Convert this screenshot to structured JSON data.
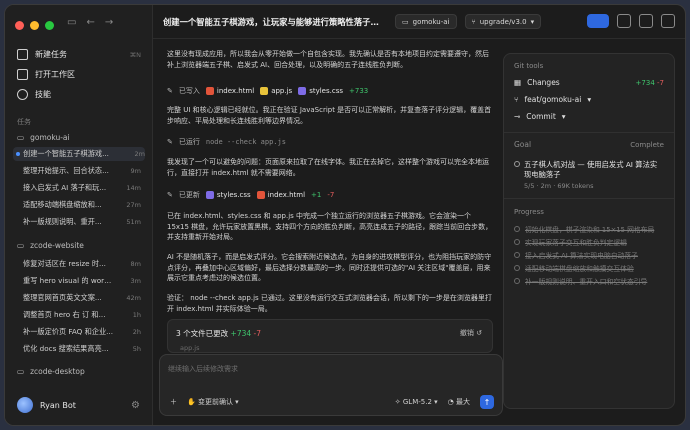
{
  "sidebar": {
    "nav": [
      {
        "label": "新建任务",
        "shortcut": "⌘N"
      },
      {
        "label": "打开工作区",
        "shortcut": ""
      },
      {
        "label": "技能",
        "shortcut": ""
      }
    ],
    "section_label": "任务",
    "groups": [
      {
        "name": "gomoku-ai",
        "tasks": [
          {
            "title": "创建一个智能五子棋游戏...",
            "age": "2m",
            "active": true
          },
          {
            "title": "整理开始提示、回合状态...",
            "age": "9m"
          },
          {
            "title": "接入启发式 AI 落子和玩...",
            "age": "14m"
          },
          {
            "title": "适配移动端棋盘缩放和...",
            "age": "27m"
          },
          {
            "title": "补一版规则说明、重开...",
            "age": "51m"
          }
        ]
      },
      {
        "name": "zcode-website",
        "tasks": [
          {
            "title": "修复对话区在 resize 时...",
            "age": "8m"
          },
          {
            "title": "重写 hero visual 的 work...",
            "age": "3m"
          },
          {
            "title": "整理官网首页英文文案...",
            "age": "42m"
          },
          {
            "title": "调整首页 hero 右 订 和...",
            "age": "1h"
          },
          {
            "title": "补一版定价页 FAQ 和企业...",
            "age": "2h"
          },
          {
            "title": "优化 docs 搜索结果高亮...",
            "age": "5h"
          }
        ]
      },
      {
        "name": "zcode-desktop",
        "tasks": []
      }
    ],
    "user": {
      "name": "Ryan Bot"
    }
  },
  "header": {
    "title": "创建一个智能五子棋游戏，让玩家与能够进行策略性落子并准确判断...",
    "workspace": "gomoku-ai",
    "branch": "upgrade/v3.0"
  },
  "chat": {
    "p1": "这里没有现成应用，所以我会从零开始做一个自包含实现。我先确认是否有本地项目约定需要遵守，然后补上浏览器端五子棋、启发式 AI、回合处理，以及明确的五子连线胜负判断。",
    "write_label": "已写入",
    "write_files": [
      "index.html",
      "app.js",
      "styles.css"
    ],
    "write_diff": "+733",
    "p2": "完整 UI 和核心逻辑已经就位。我正在验证 JavaScript 是否可以正常解析，并复查落子评分逻辑，覆盖首步响应、平局处理和长连线胜利等边界情况。",
    "run_label": "已运行",
    "run_cmd": "node --check app.js",
    "p3": "我发现了一个可以避免的问题：页面原来拉取了在线字体。我正在去掉它，这样整个游戏可以完全本地运行，直接打开 index.html 就不需要网络。",
    "update_label": "已更新",
    "update_files": [
      "styles.css",
      "index.html"
    ],
    "update_add": "+1",
    "update_del": "-7",
    "p4": "已在 index.html、styles.css 和 app.js 中完成一个独立运行的浏览器五子棋游戏。它会渲染一个 15x15 棋盘，允许玩家放置黑棋，支持四个方向的胜负判断，高亮连成五子的路径，跟踪当前回合步数，并支持重新开始对局。",
    "p5": "AI 不是随机落子，而是启发式评分。它会搜索附近候选点，为自身的进攻棋型评分，也为阻挡玩家的防守点评分，再叠加中心区域偏好，最后选择分数最高的一步。同时还提供可选的\"AI 关注区域\"覆盖层，用来展示它重点考虑过的候选位置。",
    "p6": "验证： node --check app.js 已通过。这里没有运行交互式浏览器会话，所以剩下的一步是在浏览器里打开 index.html 并实际体验一局。",
    "changes_header": "3 个文件已更改",
    "changes_add": "+734",
    "changes_del": "-7",
    "undo_label": "撤销",
    "changes_first_file": "app.js"
  },
  "composer": {
    "placeholder": "继续输入后续修改需求",
    "approve_label": "变更前确认",
    "model": "GLM-5.2",
    "effort": "最大"
  },
  "right_panel": {
    "git_label": "Git tools",
    "changes_label": "Changes",
    "changes_add": "+734",
    "changes_del": "-7",
    "branch": "feat/gomoku-ai",
    "commit_label": "Commit",
    "goal_label": "Goal",
    "goal_status": "Complete",
    "goal_text": "五子棋人机对战 — 使用启发式 AI 算法实现电脑落子",
    "goal_meta": "5/5 · 2m · 69K tokens",
    "progress_label": "Progress",
    "progress": [
      "初始化棋盘，棋子渲染和 15×15 网格布局",
      "实现玩家落子交互和胜负判定逻辑",
      "接入启发式 AI 算法实现电脑自动落子",
      "适配移动端棋盘缩放和触摸交互体验",
      "补一版规则说明、重开入口和空状态引导"
    ]
  },
  "colors": {
    "accent": "#2e68e0",
    "add": "#3fc46c",
    "del": "#e25c5c"
  }
}
